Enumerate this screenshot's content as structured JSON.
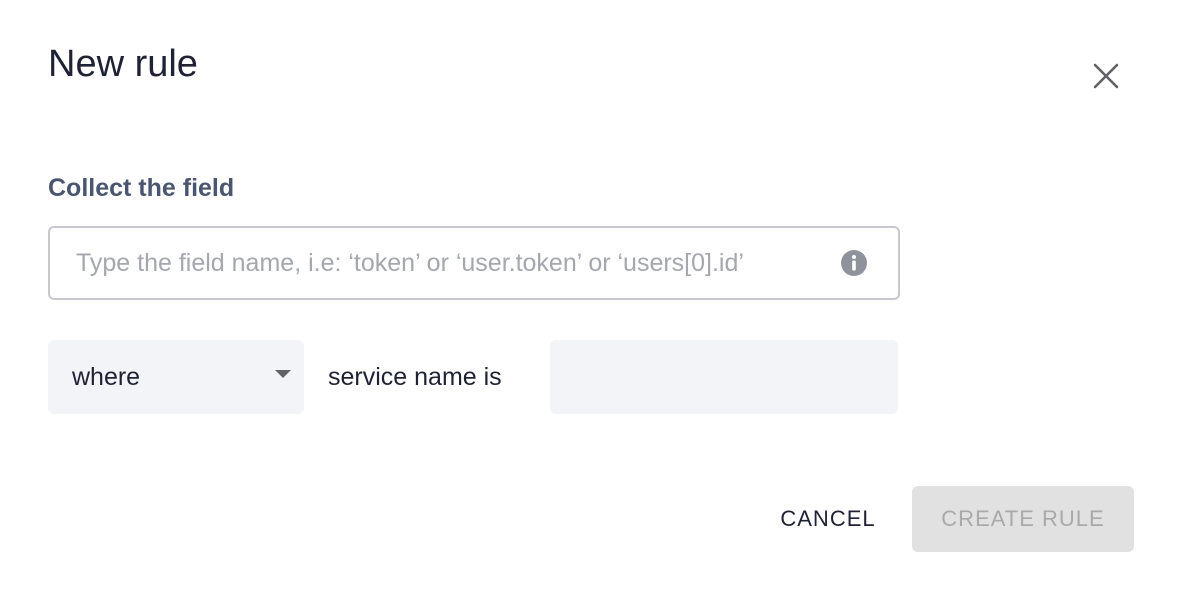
{
  "dialog": {
    "title": "New rule",
    "close_icon": "close-icon"
  },
  "collect": {
    "label": "Collect the field",
    "input_value": "",
    "input_placeholder": "Type the field name, i.e: ‘token’ or ‘user.token’ or ‘users[0].id’",
    "info_icon": "info-icon"
  },
  "condition": {
    "select_value": "where",
    "chevron_icon": "chevron-down-icon",
    "text": "service name is",
    "input_value": ""
  },
  "actions": {
    "cancel_label": "CANCEL",
    "create_label": "CREATE RULE",
    "create_enabled": false
  },
  "colors": {
    "title": "#1f2233",
    "section_label": "#4a5670",
    "input_border": "#c7c9cf",
    "placeholder": "#a4a7ae",
    "field_background": "#f3f4f8",
    "disabled_button_bg": "#e1e1e1",
    "disabled_button_text": "#a9a9a9"
  }
}
